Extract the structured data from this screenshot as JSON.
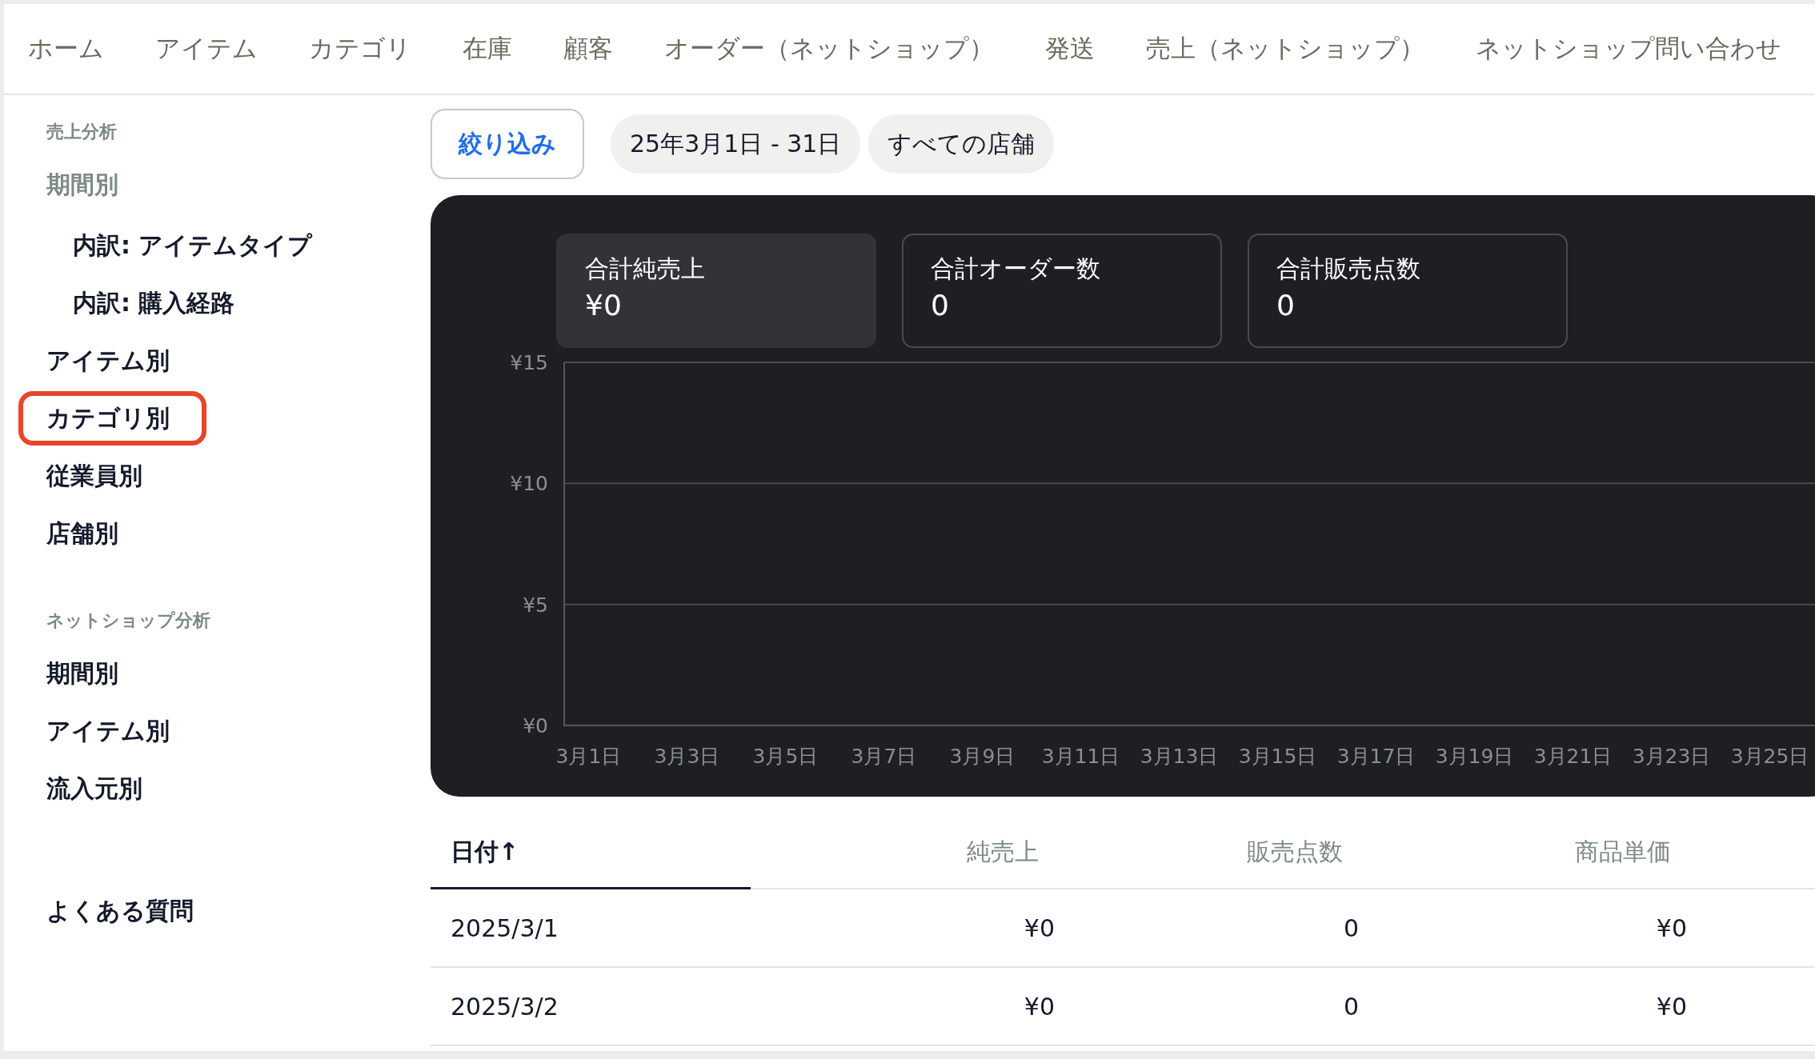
{
  "nav": {
    "items": [
      {
        "label": "ホーム"
      },
      {
        "label": "アイテム"
      },
      {
        "label": "カテゴリ"
      },
      {
        "label": "在庫"
      },
      {
        "label": "顧客"
      },
      {
        "label": "オーダー（ネットショップ）"
      },
      {
        "label": "発送"
      },
      {
        "label": "売上（ネットショップ）"
      },
      {
        "label": "ネットショップ問い合わせ"
      }
    ]
  },
  "sidebar": {
    "sections": [
      {
        "title": "売上分析",
        "items": [
          {
            "label": "期間別",
            "dimmed": true,
            "highlighted": false,
            "children": [
              {
                "label": "内訳: アイテムタイプ",
                "dimmed": false,
                "highlighted": false
              },
              {
                "label": "内訳: 購入経路",
                "dimmed": false,
                "highlighted": false
              }
            ]
          },
          {
            "label": "アイテム別",
            "dimmed": false,
            "highlighted": false
          },
          {
            "label": "カテゴリ別",
            "dimmed": false,
            "highlighted": true
          },
          {
            "label": "従業員別",
            "dimmed": false,
            "highlighted": false
          },
          {
            "label": "店舗別",
            "dimmed": false,
            "highlighted": false
          }
        ]
      },
      {
        "title": "ネットショップ分析",
        "items": [
          {
            "label": "期間別",
            "dimmed": false,
            "highlighted": false
          },
          {
            "label": "アイテム別",
            "dimmed": false,
            "highlighted": false
          },
          {
            "label": "流入元別",
            "dimmed": false,
            "highlighted": false
          }
        ]
      }
    ],
    "faq": "よくある質問"
  },
  "filters": {
    "button": "絞り込み",
    "chips": [
      "25年3月1日 - 31日",
      "すべての店舗"
    ]
  },
  "summary": {
    "cards": [
      {
        "label": "合計純売上",
        "value": "¥0",
        "selected": true
      },
      {
        "label": "合計オーダー数",
        "value": "0",
        "selected": false
      },
      {
        "label": "合計販売点数",
        "value": "0",
        "selected": false
      }
    ],
    "chart_data": {
      "type": "line",
      "categories": [
        "3月1日",
        "3月3日",
        "3月5日",
        "3月7日",
        "3月9日",
        "3月11日",
        "3月13日",
        "3月15日",
        "3月17日",
        "3月19日",
        "3月21日",
        "3月23日",
        "3月25日"
      ],
      "ylim": [
        0,
        15
      ],
      "yticks": [
        {
          "value": 0,
          "label": "¥0"
        },
        {
          "value": 5,
          "label": "¥5"
        },
        {
          "value": 10,
          "label": "¥10"
        },
        {
          "value": 15,
          "label": "¥15"
        }
      ]
    }
  },
  "table": {
    "columns": [
      {
        "label": "日付↑",
        "selected": true
      },
      {
        "label": "純売上",
        "selected": false
      },
      {
        "label": "販売点数",
        "selected": false
      },
      {
        "label": "商品単価",
        "selected": false
      }
    ],
    "rows": [
      [
        "2025/3/1",
        "¥0",
        "0",
        "¥0"
      ],
      [
        "2025/3/2",
        "¥0",
        "0",
        "¥0"
      ]
    ]
  }
}
